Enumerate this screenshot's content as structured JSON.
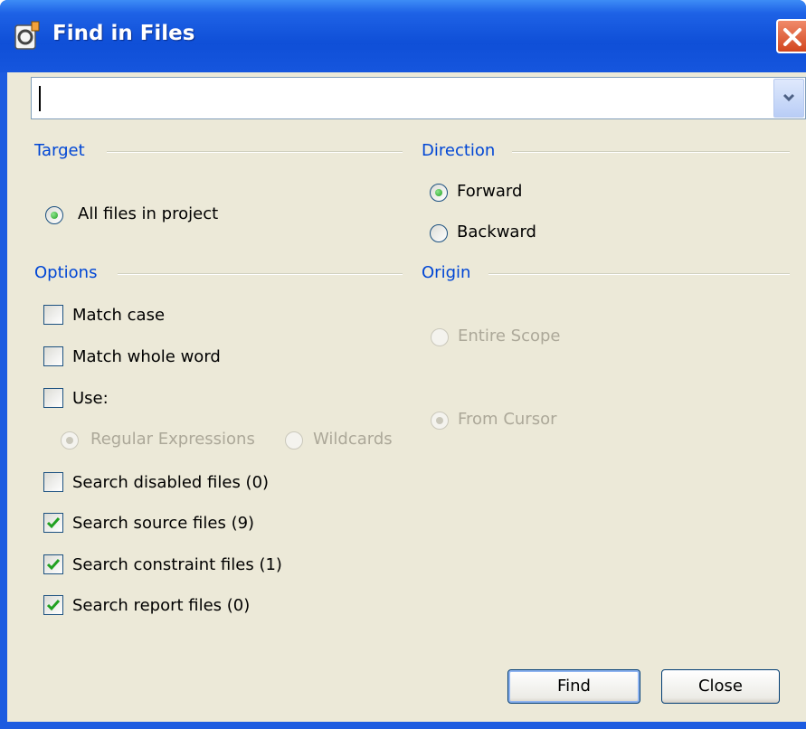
{
  "window": {
    "title": "Find in Files"
  },
  "search": {
    "value": ""
  },
  "target": {
    "label": "Target",
    "options": [
      {
        "label": "All files in project",
        "selected": true
      }
    ]
  },
  "direction": {
    "label": "Direction",
    "options": [
      {
        "label": "Forward",
        "selected": true
      },
      {
        "label": "Backward",
        "selected": false
      }
    ]
  },
  "options": {
    "label": "Options",
    "match_case": {
      "label": "Match case",
      "checked": false
    },
    "match_whole_word": {
      "label": "Match whole word",
      "checked": false
    },
    "use": {
      "label": "Use:",
      "checked": false
    },
    "use_modes": [
      {
        "label": "Regular Expressions",
        "selected": true,
        "enabled": false
      },
      {
        "label": "Wildcards",
        "selected": false,
        "enabled": false
      }
    ],
    "search_disabled": {
      "label": "Search disabled files (0)",
      "checked": false
    },
    "search_source": {
      "label": "Search source files (9)",
      "checked": true
    },
    "search_constraint": {
      "label": "Search constraint files (1)",
      "checked": true
    },
    "search_report": {
      "label": "Search report files (0)",
      "checked": true
    }
  },
  "origin": {
    "label": "Origin",
    "options": [
      {
        "label": "Entire Scope",
        "selected": false,
        "enabled": false
      },
      {
        "label": "From Cursor",
        "selected": true,
        "enabled": false
      }
    ]
  },
  "buttons": {
    "find": "Find",
    "close": "Close"
  },
  "colors": {
    "title_bar": "#1c5be0",
    "dialog_bg": "#ece9d8",
    "group_label": "#0046d5",
    "disabled_text": "#aca899"
  }
}
